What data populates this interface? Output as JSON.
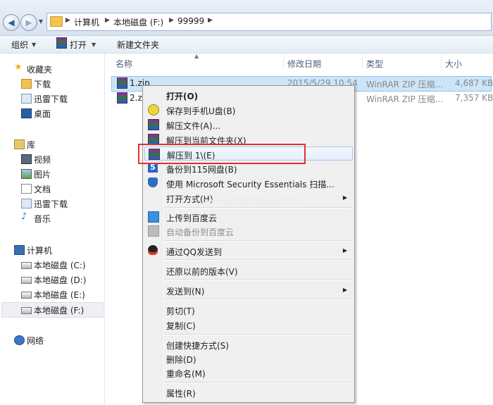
{
  "address": {
    "crumbs": [
      "计算机",
      "本地磁盘 (F:)",
      "99999"
    ]
  },
  "toolbar": {
    "organize": "组织",
    "open": "打开",
    "new_folder": "新建文件夹"
  },
  "nav": {
    "favorites": "收藏夹",
    "downloads": "下载",
    "thunder": "迅雷下载",
    "desktop": "桌面",
    "libraries": "库",
    "videos": "视频",
    "pictures": "图片",
    "documents": "文档",
    "lib_thunder": "迅雷下载",
    "music": "音乐",
    "computer": "计算机",
    "drive_c": "本地磁盘 (C:)",
    "drive_d": "本地磁盘 (D:)",
    "drive_e": "本地磁盘 (E:)",
    "drive_f": "本地磁盘 (F:)",
    "network": "网络"
  },
  "columns": {
    "name": "名称",
    "modified": "修改日期",
    "type": "类型",
    "size": "大小"
  },
  "files": [
    {
      "name": "1.zip",
      "modified": "2015/5/29 10:54",
      "type": "WinRAR ZIP 压缩...",
      "size": "4,687 KB"
    },
    {
      "name": "2.zi",
      "modified": "",
      "type": "WinRAR ZIP 压缩...",
      "size": "7,357 KB"
    }
  ],
  "menu": {
    "open": "打开(O)",
    "save_usb": "保存到手机U盘(B)",
    "extract_files": "解压文件(A)...",
    "extract_here": "解压到当前文件夹(X)",
    "extract_to": "解压到 1\\(E)",
    "backup_115": "备份到115网盘(B)",
    "mse_scan": "使用 Microsoft Security Essentials 扫描...",
    "open_with": "打开方式(H)",
    "upload_baidu": "上传到百度云",
    "auto_backup_baidu": "自动备份到百度云",
    "send_qq": "通过QQ发送到",
    "restore_prev": "还原以前的版本(V)",
    "send_to": "发送到(N)",
    "cut": "剪切(T)",
    "copy": "复制(C)",
    "create_shortcut": "创建快捷方式(S)",
    "delete": "删除(D)",
    "rename": "重命名(M)",
    "properties": "属性(R)"
  },
  "watermark": "www.qinpinchang.com",
  "colors": {
    "highlight_box": "#e0312f",
    "selection": "#cce5f9"
  }
}
